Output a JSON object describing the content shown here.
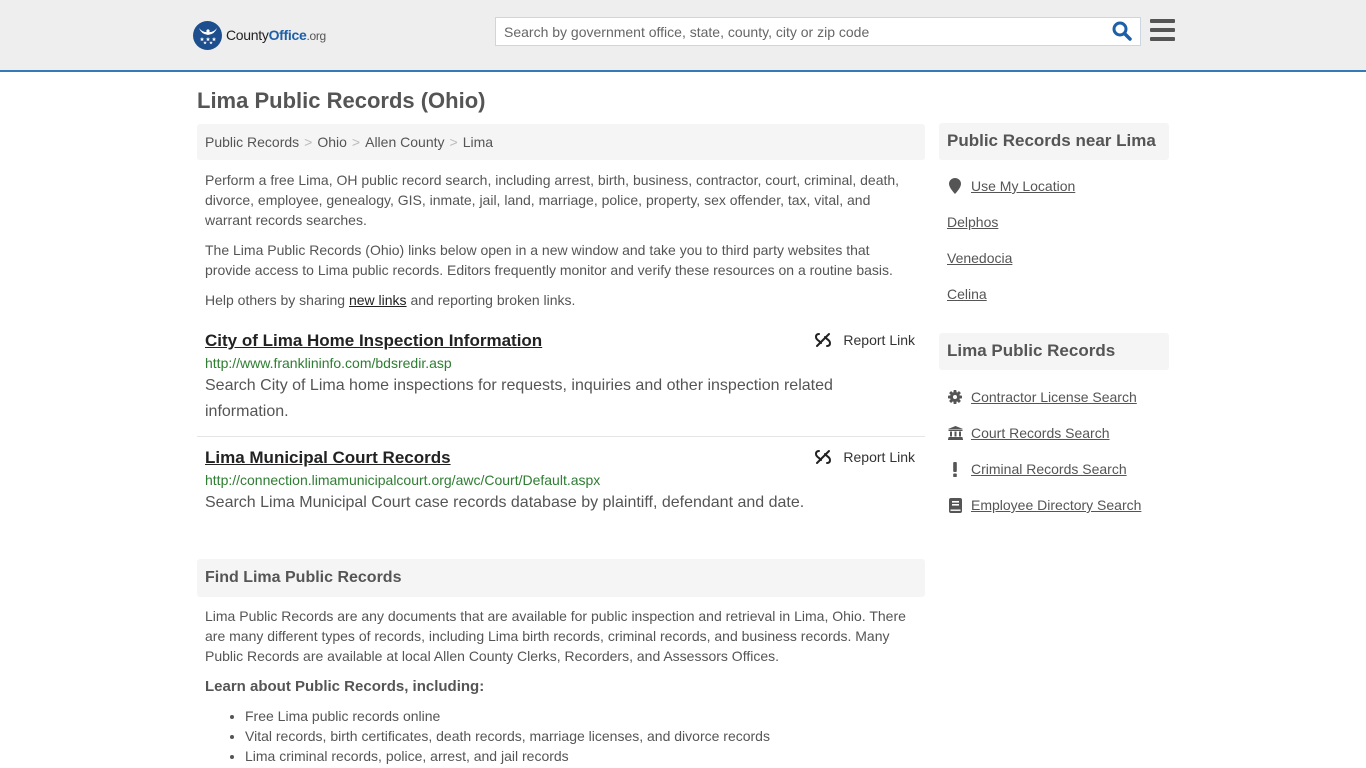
{
  "header": {
    "logo": {
      "name_part1": "County",
      "name_part2": "Office",
      "tld": ".org"
    },
    "search": {
      "placeholder": "Search by government office, state, county, city or zip code",
      "value": ""
    },
    "colors": {
      "accent": "#337ab7",
      "logo_blue": "#1d4f8e",
      "header_bg": "#eeeeee"
    }
  },
  "page": {
    "title": "Lima Public Records (Ohio)",
    "breadcrumb": [
      {
        "label": "Public Records"
      },
      {
        "label": "Ohio"
      },
      {
        "label": "Allen County"
      },
      {
        "label": "Lima"
      }
    ],
    "breadcrumb_separator": ">",
    "intro": {
      "p1": "Perform a free Lima, OH public record search, including arrest, birth, business, contractor, court, criminal, death, divorce, employee, genealogy, GIS, inmate, jail, land, marriage, police, property, sex offender, tax, vital, and warrant records searches.",
      "p2": "The Lima Public Records (Ohio) links below open in a new window and take you to third party websites that provide access to Lima public records. Editors frequently monitor and verify these resources on a routine basis.",
      "p3_before": "Help others by sharing ",
      "p3_link": "new links",
      "p3_after": " and reporting broken links."
    },
    "links": [
      {
        "title": "City of Lima Home Inspection Information",
        "url": "http://www.franklininfo.com/bdsredir.asp",
        "description": "Search City of Lima home inspections for requests, inquiries and other inspection related information.",
        "report_label": "Report Link"
      },
      {
        "title": "Lima Municipal Court Records",
        "url": "http://connection.limamunicipalcourt.org/awc/Court/Default.aspx",
        "description": "Search Lima Municipal Court case records database by plaintiff, defendant and date.",
        "report_label": "Report Link"
      }
    ],
    "find_section": {
      "heading": "Find Lima Public Records",
      "text": "Lima Public Records are any documents that are available for public inspection and retrieval in Lima, Ohio. There are many different types of records, including Lima birth records, criminal records, and business records. Many Public Records are available at local Allen County Clerks, Recorders, and Assessors Offices.",
      "learn_heading": "Learn about Public Records, including:",
      "learn_items": [
        "Free Lima public records online",
        "Vital records, birth certificates, death records, marriage licenses, and divorce records",
        "Lima criminal records, police, arrest, and jail records"
      ]
    }
  },
  "sidebar": {
    "nearby": {
      "heading": "Public Records near Lima",
      "use_location": {
        "label": "Use My Location",
        "icon": "map-marker-icon"
      },
      "places": [
        "Delphos",
        "Venedocia",
        "Celina"
      ]
    },
    "records": {
      "heading": "Lima Public Records",
      "items": [
        {
          "label": "Contractor License Search",
          "icon": "gear-icon"
        },
        {
          "label": "Court Records Search",
          "icon": "courthouse-icon"
        },
        {
          "label": "Criminal Records Search",
          "icon": "exclamation-icon"
        },
        {
          "label": "Employee Directory Search",
          "icon": "book-icon"
        }
      ]
    }
  }
}
